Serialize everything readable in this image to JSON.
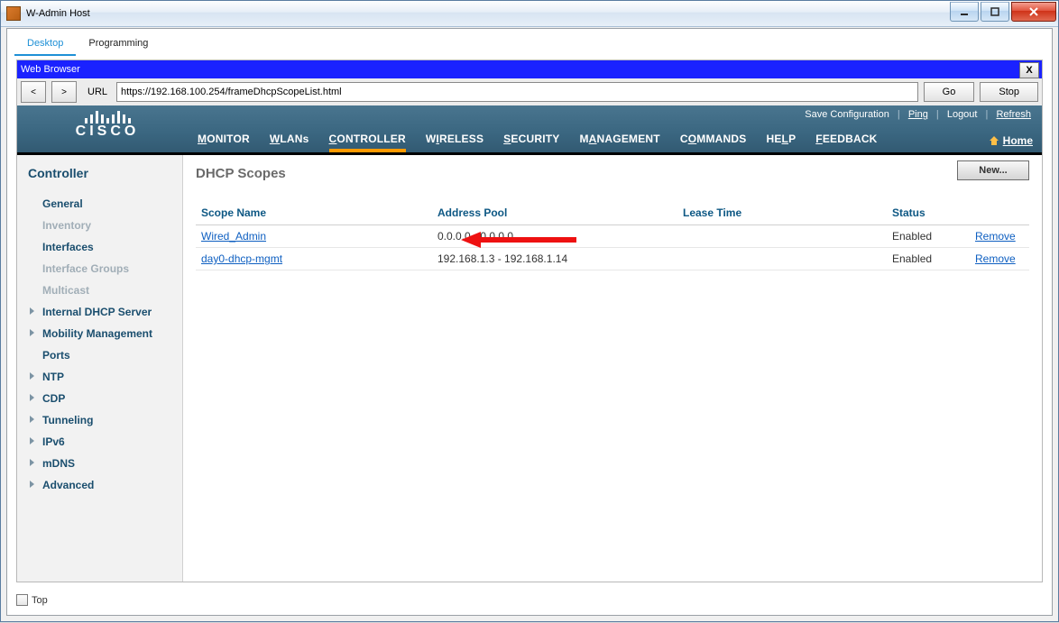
{
  "window": {
    "title": "W-Admin Host"
  },
  "subtabs": {
    "desktop": "Desktop",
    "programming": "Programming"
  },
  "web_browser": {
    "title": "Web Browser",
    "close": "X"
  },
  "urlbar": {
    "back": "<",
    "forward": ">",
    "url_label": "URL",
    "url_value": "https://192.168.100.254/frameDhcpScopeList.html",
    "go": "Go",
    "stop": "Stop"
  },
  "brand": {
    "name": "CISCO"
  },
  "top_right": {
    "save": "Save Configuration",
    "ping": "Ping",
    "logout": "Logout",
    "refresh": "Refresh"
  },
  "nav": {
    "monitor": "MONITOR",
    "wlans": "WLANs",
    "controller": "CONTROLLER",
    "wireless": "WIRELESS",
    "security": "SECURITY",
    "management": "MANAGEMENT",
    "commands": "COMMANDS",
    "help": "HELP",
    "feedback": "FEEDBACK",
    "home": "Home"
  },
  "sidebar": {
    "heading": "Controller",
    "items": [
      {
        "label": "General"
      },
      {
        "label": "Inventory",
        "dim": true
      },
      {
        "label": "Interfaces"
      },
      {
        "label": "Interface Groups",
        "dim": true
      },
      {
        "label": "Multicast",
        "dim": true
      },
      {
        "label": "Internal DHCP Server",
        "tri": true
      },
      {
        "label": "Mobility Management",
        "tri": true
      },
      {
        "label": "Ports"
      },
      {
        "label": "NTP",
        "tri": true
      },
      {
        "label": "CDP",
        "tri": true
      },
      {
        "label": "Tunneling",
        "tri": true
      },
      {
        "label": "IPv6",
        "tri": true
      },
      {
        "label": "mDNS",
        "tri": true
      },
      {
        "label": "Advanced",
        "tri": true
      }
    ]
  },
  "page": {
    "title": "DHCP Scopes",
    "new_btn": "New...",
    "columns": {
      "scope": "Scope Name",
      "pool": "Address Pool",
      "lease": "Lease Time",
      "status": "Status"
    },
    "remove": "Remove",
    "rows": [
      {
        "name": "Wired_Admin",
        "pool": "0.0.0.0 - 0.0.0.0",
        "lease": "",
        "status": "Enabled"
      },
      {
        "name": "day0-dhcp-mgmt",
        "pool": "192.168.1.3 - 192.168.1.14",
        "lease": "",
        "status": "Enabled"
      }
    ]
  },
  "bottom": {
    "top_checkbox_label": "Top"
  }
}
